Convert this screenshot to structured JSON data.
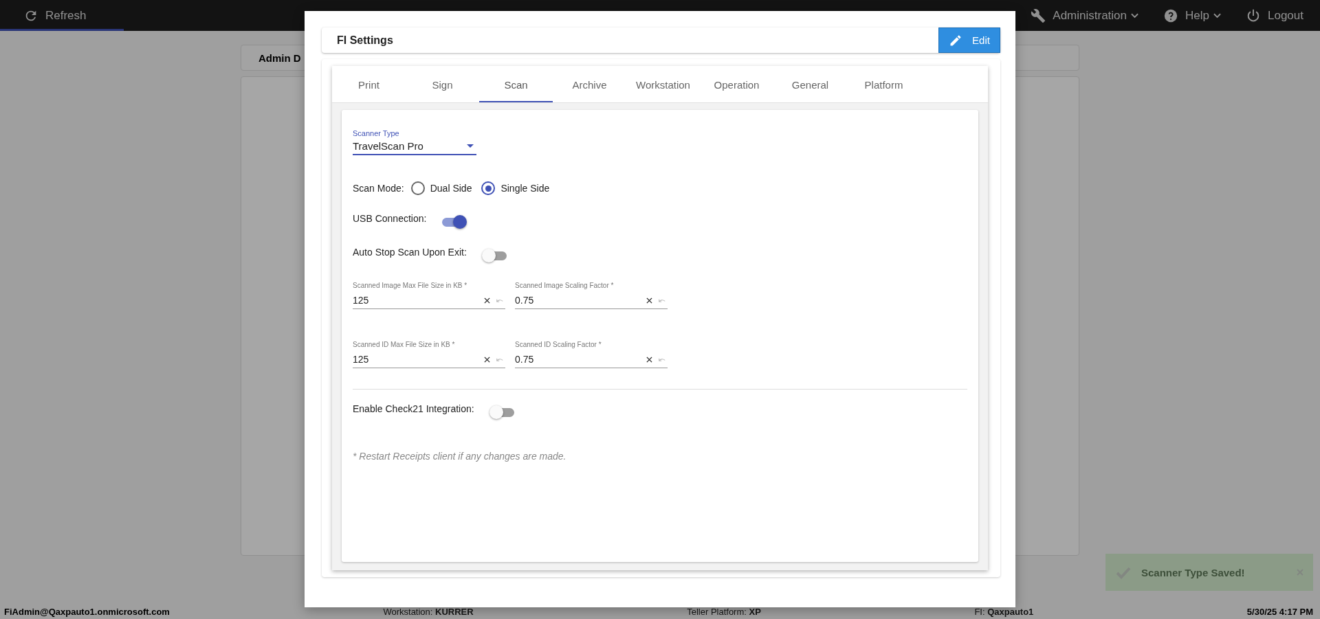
{
  "top_bar": {
    "refresh": "Refresh",
    "menus": [
      {
        "kind": "admin",
        "label": "Administration",
        "has_menu": true
      },
      {
        "kind": "help",
        "label": "Help",
        "has_menu": true
      },
      {
        "kind": "logout",
        "label": "Logout",
        "has_menu": false
      }
    ]
  },
  "background": {
    "panel_title": "Admin D"
  },
  "modal": {
    "title": "FI Settings",
    "edit_button": "Edit",
    "tabs": [
      {
        "label": "Print",
        "selected": false
      },
      {
        "label": "Sign",
        "selected": false
      },
      {
        "label": "Scan",
        "selected": true
      },
      {
        "label": "Archive",
        "selected": false
      },
      {
        "label": "Workstation",
        "selected": false
      },
      {
        "label": "Operation",
        "selected": false
      },
      {
        "label": "General",
        "selected": false
      },
      {
        "label": "Platform",
        "selected": false
      }
    ],
    "scanner_type": {
      "label": "Scanner Type",
      "value": "TravelScan Pro"
    },
    "scan_mode": {
      "label": "Scan Mode:",
      "options": [
        {
          "label": "Dual Side",
          "selected": false
        },
        {
          "label": "Single Side",
          "selected": true
        }
      ]
    },
    "toggles": [
      {
        "label": "USB Connection:",
        "on": true
      },
      {
        "label": "Auto Stop Scan Upon Exit:",
        "on": false
      }
    ],
    "fields": [
      {
        "label": "Scanned Image Max File Size in KB *",
        "value": "125"
      },
      {
        "label": "Scanned Image Scaling Factor *",
        "value": "0.75"
      },
      {
        "label": "Scanned ID Max File Size in KB *",
        "value": "125"
      },
      {
        "label": "Scanned ID Scaling Factor *",
        "value": "0.75"
      }
    ],
    "check21": {
      "label": "Enable Check21 Integration:",
      "on": false
    },
    "note": "* Restart Receipts client if any changes are made."
  },
  "toast": {
    "message": "Scanner Type Saved!"
  },
  "status_bar": {
    "user": "FiAdmin@Qaxpauto1.onmicrosoft.com",
    "items": [
      "Workstation: **KURRER**",
      "Teller Platform: **XP**",
      "FI: **Qaxpauto1**"
    ],
    "datetime": "5/30/25 4:17 PM"
  }
}
